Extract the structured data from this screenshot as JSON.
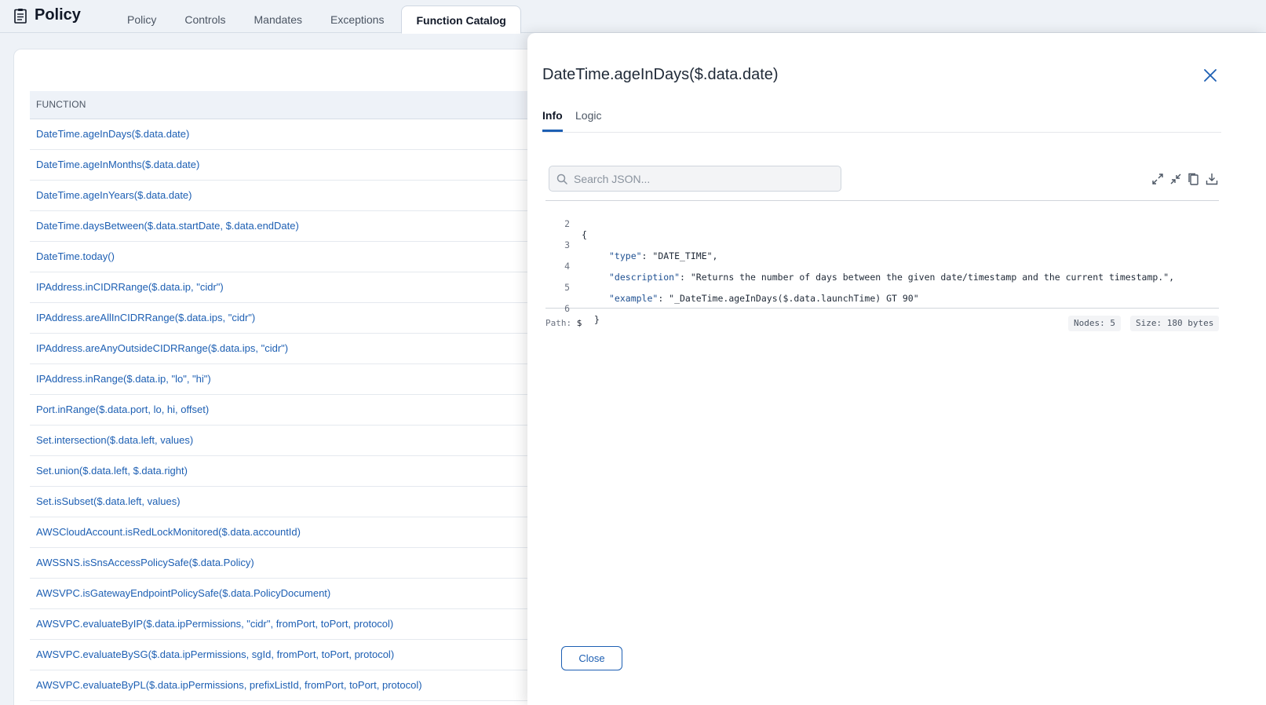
{
  "app": {
    "title": "Policy",
    "icon": "clipboard-icon"
  },
  "nav": {
    "tabs": [
      {
        "label": "Policy",
        "active": false
      },
      {
        "label": "Controls",
        "active": false
      },
      {
        "label": "Mandates",
        "active": false
      },
      {
        "label": "Exceptions",
        "active": false
      },
      {
        "label": "Function Catalog",
        "active": true
      }
    ]
  },
  "table": {
    "header": "FUNCTION",
    "rows": [
      "DateTime.ageInDays($.data.date)",
      "DateTime.ageInMonths($.data.date)",
      "DateTime.ageInYears($.data.date)",
      "DateTime.daysBetween($.data.startDate, $.data.endDate)",
      "DateTime.today()",
      "IPAddress.inCIDRRange($.data.ip, \"cidr\")",
      "IPAddress.areAllInCIDRRange($.data.ips, \"cidr\")",
      "IPAddress.areAnyOutsideCIDRRange($.data.ips, \"cidr\")",
      "IPAddress.inRange($.data.ip, \"lo\", \"hi\")",
      "Port.inRange($.data.port, lo, hi, offset)",
      "Set.intersection($.data.left, values)",
      "Set.union($.data.left, $.data.right)",
      "Set.isSubset($.data.left, values)",
      "AWSCloudAccount.isRedLockMonitored($.data.accountId)",
      "AWSSNS.isSnsAccessPolicySafe($.data.Policy)",
      "AWSVPC.isGatewayEndpointPolicySafe($.data.PolicyDocument)",
      "AWSVPC.evaluateByIP($.data.ipPermissions, \"cidr\", fromPort, toPort, protocol)",
      "AWSVPC.evaluateBySG($.data.ipPermissions, sgId, fromPort, toPort, protocol)",
      "AWSVPC.evaluateByPL($.data.ipPermissions, prefixListId, fromPort, toPort, protocol)"
    ]
  },
  "drawer": {
    "title": "DateTime.ageInDays($.data.date)",
    "tabs": {
      "info": "Info",
      "logic": "Logic"
    },
    "active_tab": "Info",
    "search": {
      "placeholder": "Search JSON..."
    },
    "toolbar": [
      "expand-icon",
      "collapse-icon",
      "copy-icon",
      "download-icon"
    ],
    "json_lines": [
      {
        "n": "2",
        "key": "",
        "value": "{"
      },
      {
        "n": "3",
        "key": "\"type\"",
        "value": ": \"DATE_TIME\","
      },
      {
        "n": "4",
        "key": "\"description\"",
        "value": ": \"Returns the number of days between the given date/timestamp and the current timestamp.\","
      },
      {
        "n": "5",
        "key": "\"example\"",
        "value": ": \"_DateTime.ageInDays($.data.launchTime) GT 90\""
      },
      {
        "n": "6",
        "key": "",
        "value": "}"
      }
    ],
    "path_label": "Path:",
    "path_value": "$",
    "nodes": "Nodes: 5",
    "size": "Size: 180 bytes",
    "close_label": "Close"
  },
  "colors": {
    "accent": "#1d5fb3",
    "link": "#1d5fb3",
    "header_bg": "#eef2f8"
  }
}
